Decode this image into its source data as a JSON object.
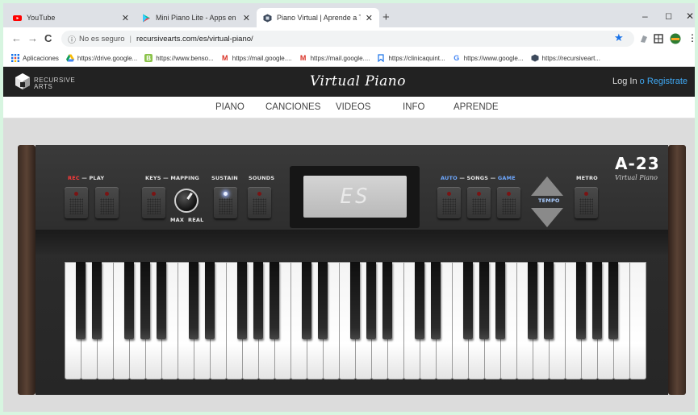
{
  "browser": {
    "tabs": [
      {
        "title": "YouTube",
        "icon": "youtube-icon",
        "active": false
      },
      {
        "title": "Mini Piano Lite - Apps en Google",
        "icon": "google-play-icon",
        "active": false
      },
      {
        "title": "Piano Virtual | Aprende a Tocar e",
        "icon": "recursive-arts-icon",
        "active": true
      }
    ],
    "new_tab": "+",
    "window_controls": {
      "minimize": "–",
      "maximize": "◻",
      "close": "✕"
    },
    "nav": {
      "back": "←",
      "forward": "→",
      "reload": "C"
    },
    "security_label": "No es seguro",
    "url": "recursivearts.com/es/virtual-piano/",
    "bookmarks": [
      {
        "label": "Aplicaciones",
        "icon": "apps-grid-icon",
        "color": "#1a73e8"
      },
      {
        "label": "https://drive.google...",
        "icon": "google-drive-icon",
        "color": "#fbbc04"
      },
      {
        "label": "https://www.benso...",
        "icon": "bookmark-b-icon",
        "color": "#4caf50"
      },
      {
        "label": "https://mail.google....",
        "icon": "gmail-icon",
        "color": "#d93025"
      },
      {
        "label": "https://mail.google....",
        "icon": "gmail-icon",
        "color": "#d93025"
      },
      {
        "label": "https://clinicaquint...",
        "icon": "bookmark-icon",
        "color": "#1a73e8"
      },
      {
        "label": "https://www.google...",
        "icon": "google-icon",
        "color": "#4285f4"
      },
      {
        "label": "https://recursiveart...",
        "icon": "recursive-arts-icon",
        "color": "#555555"
      }
    ]
  },
  "site": {
    "logo_line1": "RECURSIVE",
    "logo_line2": "ARTS",
    "title": "Virtual Piano",
    "login": "Log In",
    "login_sep": "o",
    "register": "Registrate",
    "nav": [
      "PIANO",
      "CANCIONES",
      "VIDEOS",
      "INFO",
      "APRENDE"
    ]
  },
  "piano": {
    "labels": {
      "rec": "REC",
      "play": "PLAY",
      "keys": "KEYS",
      "mapping": "MAPPING",
      "sustain": "SUSTAIN",
      "sounds": "SOUNDS",
      "max": "MAX",
      "real": "REAL",
      "auto": "AUTO",
      "songs": "SONGS",
      "game": "GAME",
      "tempo": "TEMPO",
      "metro": "METRO",
      "dash": "—"
    },
    "display_value": "ES",
    "model": "A-23",
    "model_sub": "Virtual Piano",
    "sustain_on": true,
    "white_keys": 36,
    "colors": {
      "accent_red": "#ff3b3b",
      "accent_blue": "#6ea8ff",
      "header_bg": "#222222"
    }
  }
}
